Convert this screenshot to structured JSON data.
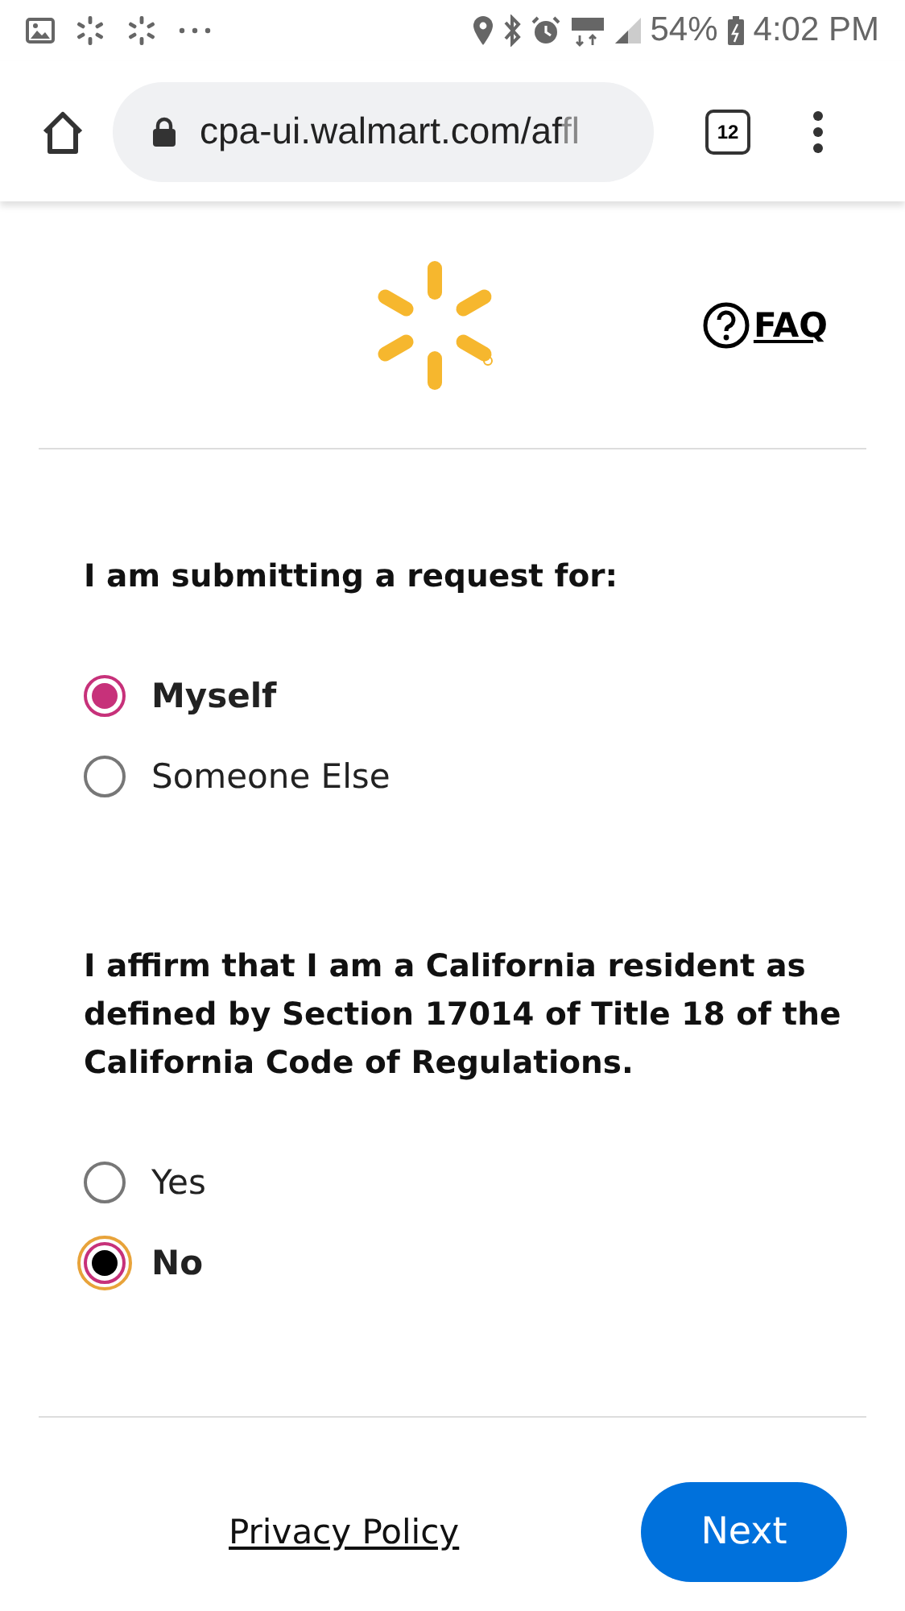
{
  "status_bar": {
    "battery": "54%",
    "time": "4:02 PM"
  },
  "browser": {
    "url": "cpa-ui.walmart.com/af",
    "url_faded": "fl",
    "tab_count": "12"
  },
  "header": {
    "faq": "FAQ"
  },
  "questions": [
    {
      "prompt": "I am submitting a request for:",
      "options": [
        {
          "label": "Myself",
          "selected": true,
          "focused": false
        },
        {
          "label": "Someone Else",
          "selected": false,
          "focused": false
        }
      ]
    },
    {
      "prompt": "I affirm that I am a California resident as defined by Section 17014 of Title 18 of the California Code of Regulations.",
      "options": [
        {
          "label": "Yes",
          "selected": false,
          "focused": false
        },
        {
          "label": "No",
          "selected": true,
          "focused": true
        }
      ]
    }
  ],
  "footer": {
    "privacy": "Privacy Policy",
    "next": "Next"
  }
}
